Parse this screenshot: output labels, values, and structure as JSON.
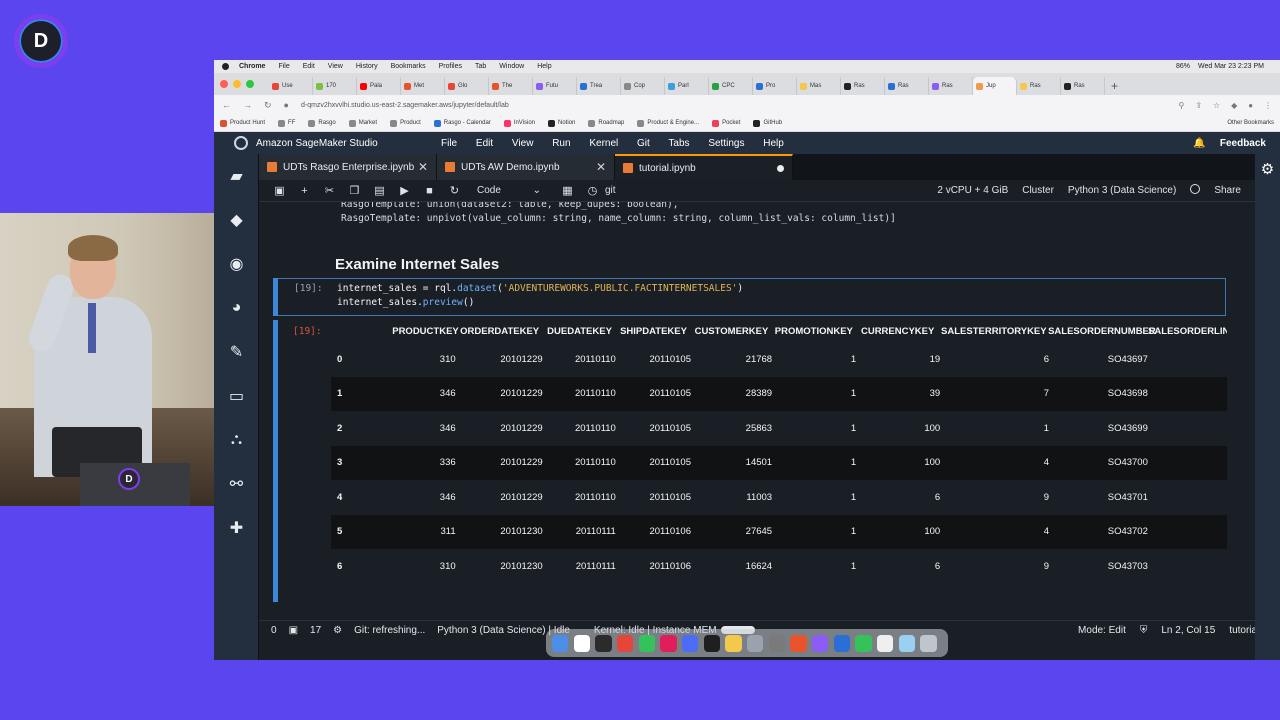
{
  "presenter_badge": "D",
  "webcam": {
    "podium_logo": "D"
  },
  "mac_menubar": {
    "items": [
      "Chrome",
      "File",
      "Edit",
      "View",
      "History",
      "Bookmarks",
      "Profiles",
      "Tab",
      "Window",
      "Help"
    ],
    "battery": "86%",
    "datetime": "Wed Mar 23  2:23 PM"
  },
  "chrome_tabs": [
    {
      "label": "Use",
      "color": "#e6453a"
    },
    {
      "label": "170",
      "color": "#7ac143"
    },
    {
      "label": "Pala",
      "color": "#ff0000"
    },
    {
      "label": "Met",
      "color": "#e9532b"
    },
    {
      "label": "Glo",
      "color": "#e6453a"
    },
    {
      "label": "The",
      "color": "#e9532b"
    },
    {
      "label": "Futu",
      "color": "#8b5cf6"
    },
    {
      "label": "Trea",
      "color": "#2a6fd6"
    },
    {
      "label": "Cop",
      "color": "#888888"
    },
    {
      "label": "Parl",
      "color": "#3aa0d8"
    },
    {
      "label": "CPC",
      "color": "#2e9e44"
    },
    {
      "label": "Pro",
      "color": "#2a6fd6"
    },
    {
      "label": "Mas",
      "color": "#f2c94c"
    },
    {
      "label": "Ras",
      "color": "#222222"
    },
    {
      "label": "Ras",
      "color": "#2a6fd6"
    },
    {
      "label": "Ras",
      "color": "#8b5cf6"
    },
    {
      "label": "Jup",
      "color": "#f2994a"
    },
    {
      "label": "Ras",
      "color": "#f2c94c"
    },
    {
      "label": "Ras",
      "color": "#222222"
    }
  ],
  "active_chrome_tab_index": 16,
  "address_bar": {
    "url": "d-qmzv2hxvvlhi.studio.us-east-2.sagemaker.aws/jupyter/default/lab"
  },
  "bookmarks": [
    {
      "label": "Product Hunt",
      "color": "#da552f"
    },
    {
      "label": "FF",
      "color": "#888888"
    },
    {
      "label": "Rasgo",
      "color": "#888888"
    },
    {
      "label": "Market",
      "color": "#888888"
    },
    {
      "label": "Product",
      "color": "#888888"
    },
    {
      "label": "Rasgo - Calendar",
      "color": "#2a6fd6"
    },
    {
      "label": "InVision",
      "color": "#ff3366"
    },
    {
      "label": "Notion",
      "color": "#222222"
    },
    {
      "label": "Roadmap",
      "color": "#888888"
    },
    {
      "label": "Product & Engine...",
      "color": "#888888"
    },
    {
      "label": "Pocket",
      "color": "#ef4056"
    },
    {
      "label": "GitHub",
      "color": "#222222"
    }
  ],
  "other_bookmarks": "Other Bookmarks",
  "sagemaker": {
    "title": "Amazon SageMaker Studio",
    "menu": [
      "File",
      "Edit",
      "View",
      "Run",
      "Kernel",
      "Git",
      "Tabs",
      "Settings",
      "Help"
    ],
    "feedback": "Feedback"
  },
  "doc_tabs": [
    {
      "label": "UDTs Rasgo Enterprise.ipynb"
    },
    {
      "label": "UDTs AW Demo.ipynb"
    },
    {
      "label": "tutorial.ipynb"
    }
  ],
  "toolbar": {
    "cell_type": "Code",
    "git": "git",
    "compute": "2 vCPU + 4 GiB",
    "cluster": "Cluster",
    "kernel": "Python 3 (Data Science)",
    "share": "Share"
  },
  "notebook": {
    "prev_code_1": "RasgoTemplate: union(dataset2: table, keep_dupes: boolean),",
    "prev_code_2": "RasgoTemplate: unpivot(value_column: string, name_column: string, column_list_vals: column_list)]",
    "heading": "Examine Internet Sales",
    "in_prompt": "[19]:",
    "out_prompt": "[19]:",
    "code_line1_a": "internet_sales = rql.",
    "code_line1_fn": "dataset",
    "code_line1_b": "(",
    "code_line1_str": "'ADVENTUREWORKS.PUBLIC.FACTINTERNETSALES'",
    "code_line1_c": ")",
    "code_line2_a": "internet_sales.",
    "code_line2_fn": "preview",
    "code_line2_b": "()"
  },
  "table": {
    "columns": [
      "",
      "PRODUCTKEY",
      "ORDERDATEKEY",
      "DUEDATEKEY",
      "SHIPDATEKEY",
      "CUSTOMERKEY",
      "PROMOTIONKEY",
      "CURRENCYKEY",
      "SALESTERRITORYKEY",
      "SALESORDERNUMBER",
      "SALESORDERLINE"
    ],
    "rows": [
      [
        "0",
        "310",
        "20101229",
        "20110110",
        "20110105",
        "21768",
        "1",
        "19",
        "6",
        "SO43697",
        ""
      ],
      [
        "1",
        "346",
        "20101229",
        "20110110",
        "20110105",
        "28389",
        "1",
        "39",
        "7",
        "SO43698",
        ""
      ],
      [
        "2",
        "346",
        "20101229",
        "20110110",
        "20110105",
        "25863",
        "1",
        "100",
        "1",
        "SO43699",
        ""
      ],
      [
        "3",
        "336",
        "20101229",
        "20110110",
        "20110105",
        "14501",
        "1",
        "100",
        "4",
        "SO43700",
        ""
      ],
      [
        "4",
        "346",
        "20101229",
        "20110110",
        "20110105",
        "11003",
        "1",
        "6",
        "9",
        "SO43701",
        ""
      ],
      [
        "5",
        "311",
        "20101230",
        "20110111",
        "20110106",
        "27645",
        "1",
        "100",
        "4",
        "SO43702",
        ""
      ],
      [
        "6",
        "310",
        "20101230",
        "20110111",
        "20110106",
        "16624",
        "1",
        "6",
        "9",
        "SO43703",
        ""
      ]
    ]
  },
  "statusbar": {
    "count_a": "0",
    "count_b": "17",
    "git": "Git: refreshing...",
    "kernel": "Python 3 (Data Science) | Idle",
    "kernel_state": "Kernel: Idle | Instance MEM",
    "mode": "Mode: Edit",
    "position": "Ln 2, Col 15",
    "file": "tutorial.ipynb"
  },
  "dock_colors": [
    "#4a8ee6",
    "#ffffff",
    "#2b2b2b",
    "#e6453a",
    "#36c25a",
    "#e01e5a",
    "#4a6cf7",
    "#1f1f1f",
    "#f2c94c",
    "#9aa3ad",
    "#7a7a7a",
    "#e9532b",
    "#8b5cf6",
    "#2a6fd6",
    "#36c25a",
    "#efefef",
    "#9ad0f0",
    "#bfc5cc"
  ],
  "colors": {
    "background": "#5a45ee",
    "sagemaker_nav": "#232f3e",
    "notebook_bg": "#1a1f25",
    "accent": "#ff9900",
    "cell_border": "#3e75b5"
  }
}
